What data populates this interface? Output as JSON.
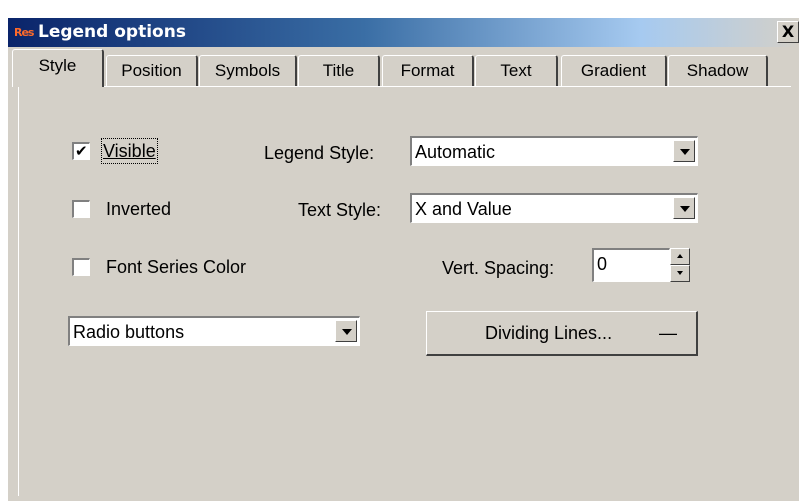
{
  "window": {
    "app_icon_text": "Res",
    "title": "Legend options",
    "close_label": "X"
  },
  "tabs": [
    {
      "label": "Style",
      "active": true
    },
    {
      "label": "Position"
    },
    {
      "label": "Symbols"
    },
    {
      "label": "Title"
    },
    {
      "label": "Format"
    },
    {
      "label": "Text"
    },
    {
      "label": "Gradient"
    },
    {
      "label": "Shadow"
    }
  ],
  "style_tab": {
    "visible": {
      "label": "Visible",
      "checked": true
    },
    "inverted": {
      "label": "Inverted",
      "checked": false
    },
    "font_series_color": {
      "label": "Font Series Color",
      "checked": false
    },
    "legend_style": {
      "label": "Legend Style:",
      "value": "Automatic"
    },
    "text_style": {
      "label": "Text Style:",
      "value": "X and Value"
    },
    "vert_spacing": {
      "label": "Vert. Spacing:",
      "value": "0"
    },
    "check_style": {
      "value": "Radio buttons"
    },
    "dividing_lines_label": "Dividing Lines...",
    "dividing_lines_preview": "—",
    "check_mark": "✔"
  }
}
